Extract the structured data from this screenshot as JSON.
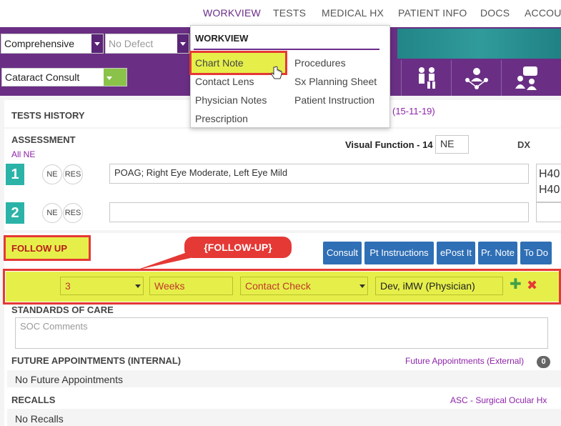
{
  "nav": {
    "tabs": [
      "WORKVIEW",
      "TESTS",
      "MEDICAL HX",
      "PATIENT INFO",
      "DOCS",
      "ACCOUN"
    ]
  },
  "toolbar": {
    "exam_type": "Comprehensive",
    "defect": "No Defect",
    "visit_type": "Cataract Consult"
  },
  "dropdown": {
    "header": "WORKVIEW",
    "col1": [
      "Chart Note",
      "Contact Lens",
      "Physician Notes",
      "Prescription"
    ],
    "col2": [
      "Procedures",
      "Sx Planning Sheet",
      "Patient Instruction"
    ]
  },
  "tests_history": {
    "title": "TESTS HISTORY",
    "date_fragment": "R (15-11-19)"
  },
  "assessment": {
    "title": "ASSESSMENT",
    "all_ne": "All NE",
    "visual_function_label": "Visual Function - 14",
    "visual_function_value": "NE",
    "dx_label": "DX",
    "rows": [
      {
        "num": "1",
        "ne": "NE",
        "res": "RES",
        "text": "POAG; Right Eye Moderate, Left Eye Mild",
        "dx1": "H40",
        "dx2": "H40"
      },
      {
        "num": "2",
        "ne": "NE",
        "res": "RES",
        "text": "",
        "dx1": "",
        "dx2": ""
      }
    ]
  },
  "follow_up": {
    "title": "FOLLOW UP",
    "callout": "{FOLLOW-UP}",
    "buttons": [
      "Consult",
      "Pt Instructions",
      "ePost It",
      "Pr. Note",
      "To Do"
    ],
    "number": "3",
    "unit": "Weeks",
    "reason": "Contact Check",
    "provider": "Dev, iMW (Physician)",
    "add_symbol": "✚",
    "remove_symbol": "✖"
  },
  "soc": {
    "title": "STANDARDS OF CARE",
    "placeholder": "SOC Comments"
  },
  "future": {
    "title": "FUTURE APPOINTMENTS (INTERNAL)",
    "external_link": "Future Appointments (External)",
    "external_count": "0",
    "empty": "No Future Appointments"
  },
  "recalls": {
    "title": "RECALLS",
    "asc_link": "ASC - Surgical Ocular Hx",
    "empty": "No Recalls"
  },
  "colors": {
    "purple": "#6a2f84",
    "teal": "#2bb3a8",
    "highlight": "#e6ef4a",
    "annotation": "#e53935",
    "button_blue": "#2f6fb5"
  }
}
